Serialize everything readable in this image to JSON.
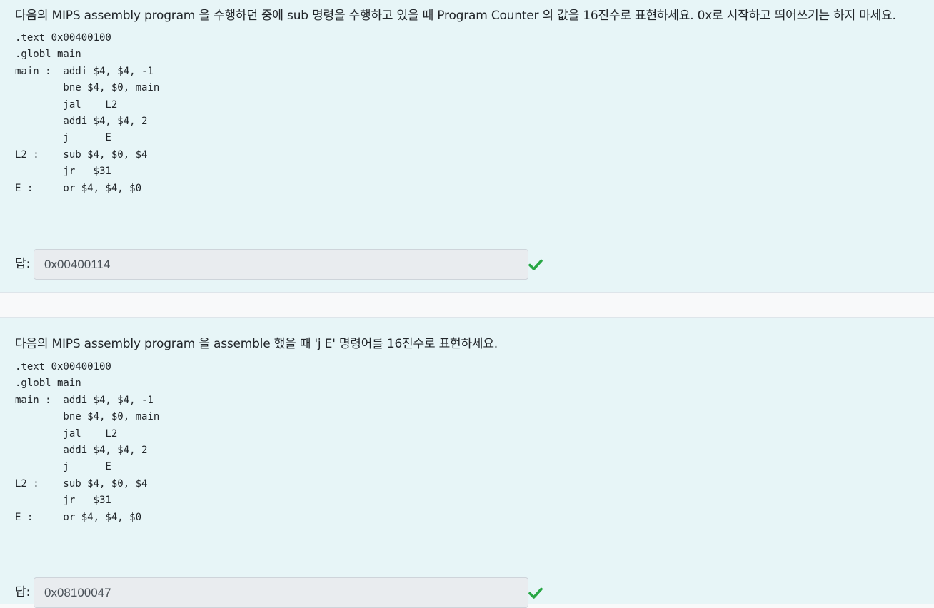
{
  "questions": [
    {
      "text": "다음의 MIPS assembly program 을 수행하던 중에 sub 명령을 수행하고 있을 때 Program Counter 의 값을 16진수로 표현하세요. 0x로 시작하고 띄어쓰기는 하지 마세요.",
      "code": [
        ".text 0x00400100",
        ".globl main",
        "main :  addi $4, $4, -1",
        "        bne $4, $0, main",
        "        jal    L2",
        "        addi $4, $4, 2",
        "        j      E",
        "L2 :    sub $4, $0, $4",
        "        jr   $31",
        "E :     or $4, $4, $0"
      ],
      "answer_label": "답:",
      "answer_value": "0x00400114",
      "status_icon": "check-icon",
      "status_color": "#28a745"
    },
    {
      "text": "다음의 MIPS assembly program 을 assemble 했을 때 'j E' 명령어를 16진수로 표현하세요.",
      "code": [
        ".text 0x00400100",
        ".globl main",
        "main :  addi $4, $4, -1",
        "        bne $4, $0, main",
        "        jal    L2",
        "        addi $4, $4, 2",
        "        j      E",
        "L2 :    sub $4, $0, $4",
        "        jr   $31",
        "E :     or $4, $4, $0"
      ],
      "answer_label": "답:",
      "answer_value": "0x08100047",
      "status_icon": "check-icon",
      "status_color": "#28a745"
    }
  ]
}
